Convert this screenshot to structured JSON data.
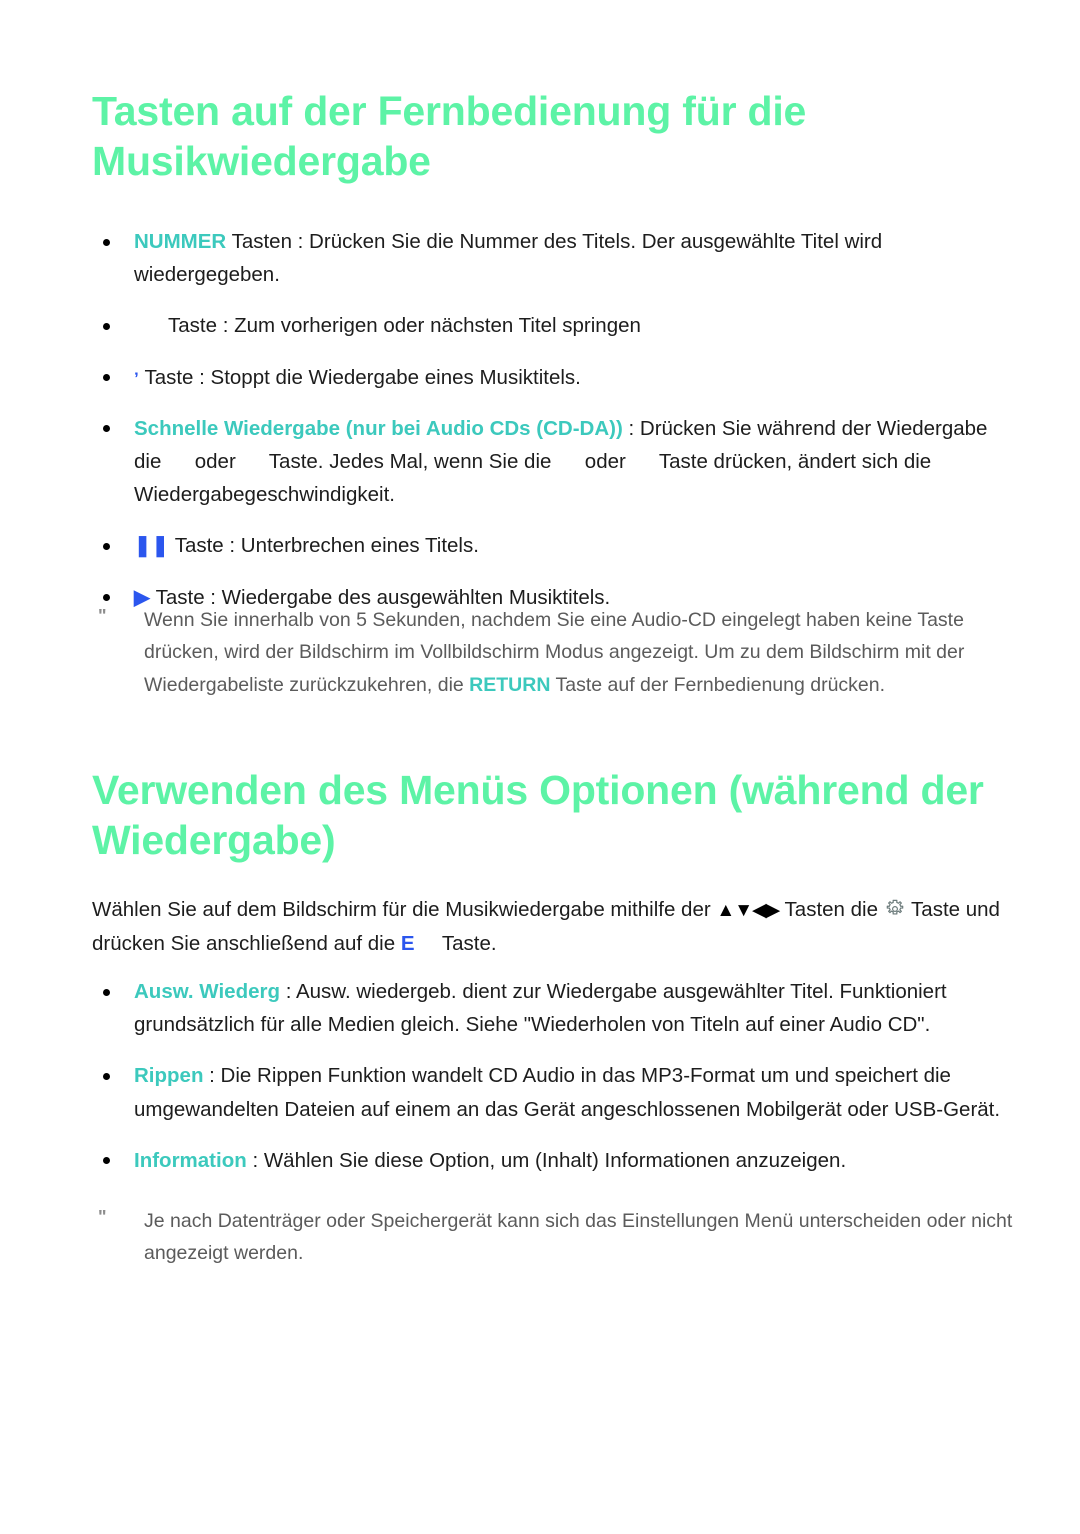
{
  "colors": {
    "heading_green": "#5df3a6",
    "accent_teal": "#3cc9bd",
    "button_blue": "#2b56ee",
    "body_text": "#1d1d1d",
    "note_text": "#5b5b5b",
    "note_marker": "#8d8d8d",
    "gear_icon": "#6b7a7a"
  },
  "sections": [
    {
      "heading": "Tasten auf der Fernbedienung für die Musikwiedergabe",
      "items": [
        {
          "accent": "NUMMER",
          "text": " Tasten : Drücken Sie die Nummer des Titels. Der ausgewählte Titel wird wiedergegeben."
        },
        {
          "glyph": "",
          "text": "Taste : Zum vorherigen oder nächsten Titel springen"
        },
        {
          "glyph": "’",
          "text": "Taste : Stoppt die Wiedergabe eines Musiktitels."
        },
        {
          "accent": "Schnelle Wiedergabe (nur bei Audio CDs (CD-DA))",
          "text_part_1": " : Drücken Sie während der Wiedergabe die ",
          "text_part_2": " oder ",
          "text_part_3": " Taste. Jedes Mal, wenn Sie die ",
          "text_part_4": " oder ",
          "text_part_5": " Taste drücken, ändert sich die Wiedergabegeschwindigkeit."
        },
        {
          "glyph": "❚❚",
          "text": "Taste : Unterbrechen eines Titels."
        },
        {
          "glyph": "▶",
          "text": "Taste : Wiedergabe des ausgewählten Musiktitels."
        }
      ],
      "note": {
        "marker": "\"",
        "text_part_1": "Wenn Sie innerhalb von 5 Sekunden, nachdem Sie eine Audio-CD eingelegt haben keine Taste drücken, wird der Bildschirm im Vollbildschirm Modus angezeigt. Um zu dem Bildschirm mit der Wiedergabeliste zurückzukehren, die ",
        "accent": "RETURN",
        "text_part_2": " Taste auf der Fernbedienung drücken."
      }
    },
    {
      "heading": "Verwenden des Menüs Optionen (während der Wiedergabe)",
      "intro": {
        "text_part_1": "Wählen Sie auf dem Bildschirm für die Musikwiedergabe mithilfe der ",
        "arrows": "▲▼◀▶",
        "text_part_2": " Tasten die ",
        "gear_icon": "gear-icon",
        "text_part_3": " Taste und drücken Sie anschließend auf die ",
        "e_key": "E",
        "text_part_4": " Taste."
      },
      "items": [
        {
          "accent": "Ausw. Wiederg",
          "text": " : Ausw. wiedergeb. dient zur Wiedergabe ausgewählter Titel. Funktioniert grundsätzlich für alle Medien gleich. Siehe \"Wiederholen von Titeln auf einer Audio CD\"."
        },
        {
          "accent": "Rippen",
          "text": " : Die Rippen Funktion wandelt CD Audio in das MP3-Format um und speichert die umgewandelten Dateien auf einem an das Gerät angeschlossenen Mobilgerät oder USB-Gerät."
        },
        {
          "accent": "Information",
          "text": " : Wählen Sie diese Option, um (Inhalt) Informationen anzuzeigen."
        }
      ],
      "note": {
        "marker": "\"",
        "text": "Je nach Datenträger oder Speichergerät kann sich das Einstellungen Menü unterscheiden oder nicht angezeigt werden."
      }
    }
  ]
}
